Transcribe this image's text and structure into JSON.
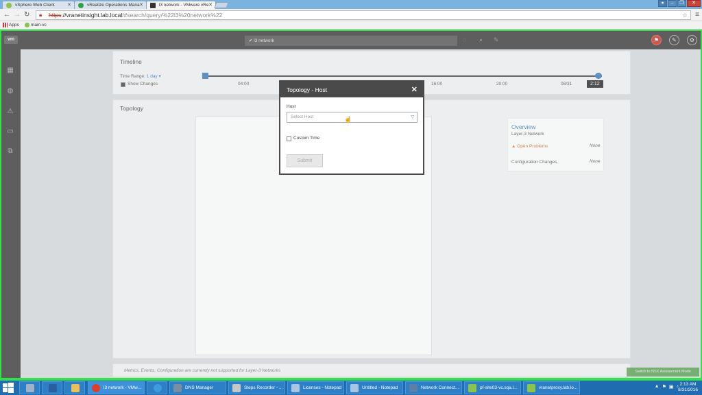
{
  "browser": {
    "tabs": [
      {
        "label": "vSphere Web Client",
        "favicon_color": "#8ac44b"
      },
      {
        "label": "vRealize Operations Mana",
        "favicon_color": "#3aa04f"
      },
      {
        "label": "l3 network - VMware vRe",
        "favicon_color": "#333333"
      }
    ],
    "url_scheme": "https",
    "url_host": "://vranetinsight.lab.local",
    "url_path": "/#search/query/%22l3%20network%22",
    "bookmarks": [
      {
        "label": "Apps"
      },
      {
        "label": "main-vc"
      }
    ]
  },
  "app": {
    "logo": "vm",
    "search_value": "l3 network",
    "colors": {
      "topbar": "#3b3b3b",
      "accent_green": "#35e04a",
      "alert": "#c1352b",
      "link_blue": "#3b78b8",
      "warning_orange": "#e07b20"
    }
  },
  "sidebar": {
    "icons": [
      "dashboard-grid-icon",
      "analytics-icon",
      "alert-triangle-icon",
      "monitor-icon",
      "search-report-icon"
    ]
  },
  "timeline": {
    "title": "Timeline",
    "time_range_label": "Time Range:",
    "time_range_value": "1 day",
    "show_changes_label": "Show Changes",
    "ticks": [
      "04:00",
      "16:00",
      "20:00",
      "08/31"
    ],
    "current_time": "2:12"
  },
  "topology": {
    "title": "Topology",
    "overview": {
      "title": "Overview",
      "subtitle": "Layer-3 Network",
      "open_problems_label": "Open Problems",
      "open_problems_value": "None",
      "config_changes_label": "Configuration Changes",
      "config_changes_value": "None"
    },
    "footer_message": "Metrics, Events, Configuration are currently not supported for Layer-3 Networks",
    "nsx_button_label": "Switch to NSX Assessment Mode"
  },
  "modal": {
    "title": "Topology - Host",
    "host_label": "Host",
    "host_placeholder": "Select Host",
    "custom_time_label": "Custom Time",
    "submit_label": "Submit"
  },
  "taskbar": {
    "items": [
      {
        "label": "l3 network - VMw...",
        "color": "#d9412f"
      },
      {
        "label": "DNS Manager",
        "color": "#7a8da1"
      },
      {
        "label": "Steps Recorder - ...",
        "color": "#c7c7c7"
      },
      {
        "label": "Licenses - Notepad",
        "color": "#a8c6e4"
      },
      {
        "label": "Untitled - Notepad",
        "color": "#a8c6e4"
      },
      {
        "label": "Network Connect...",
        "color": "#5c7fa6"
      },
      {
        "label": "pf-site03-vc.sqa.l...",
        "color": "#8ac44b"
      },
      {
        "label": "vranetproxy.lab.lo...",
        "color": "#8ac44b"
      }
    ],
    "time": "2:13 AM",
    "date": "8/31/2016"
  }
}
